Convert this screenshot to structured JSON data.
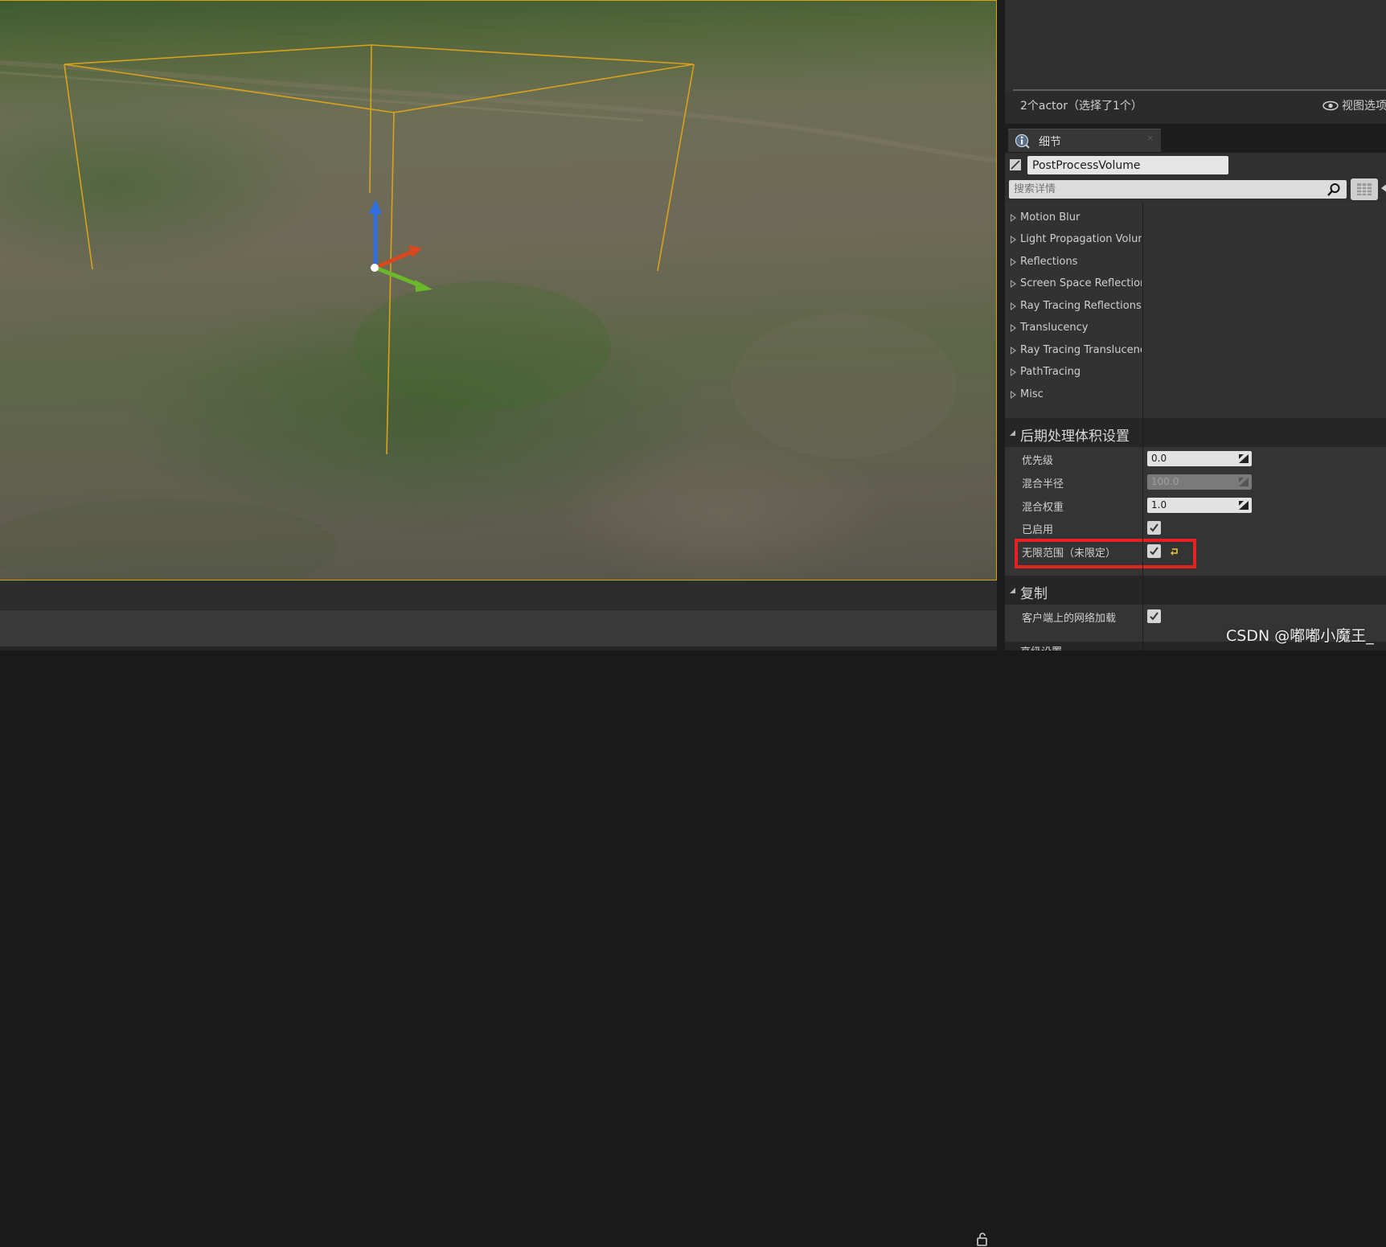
{
  "outliner": {
    "actor_count": "2个actor（选择了1个）",
    "view_options": "视图选项"
  },
  "details": {
    "tab_label": "细节",
    "tab_close": "×",
    "actor_name": "PostProcessVolume",
    "search_placeholder": "搜索详情",
    "categories": [
      "Motion Blur",
      "Light Propagation Volume",
      "Reflections",
      "Screen Space Reflections",
      "Ray Tracing Reflections",
      "Translucency",
      "Ray Tracing Translucency",
      "PathTracing",
      "Misc"
    ],
    "volume_settings": {
      "header": "后期处理体积设置",
      "priority_label": "优先级",
      "priority_value": "0.0",
      "blend_radius_label": "混合半径",
      "blend_radius_value": "100.0",
      "blend_weight_label": "混合权重",
      "blend_weight_value": "1.0",
      "enabled_label": "已启用",
      "enabled_checked": true,
      "unbound_label": "无限范围（未限定）",
      "unbound_checked": true
    },
    "replication": {
      "header": "复制",
      "net_load_label": "客户端上的网络加载",
      "net_load_checked": true
    },
    "next_section_partial": "高级设置"
  },
  "watermark": "CSDN @嘟嘟小魔王_",
  "colors": {
    "selection_outline": "#d4a417",
    "highlight_box": "#e42222",
    "gizmo_x": "#d9471f",
    "gizmo_y": "#6bb82a",
    "gizmo_z": "#2f6fe0"
  }
}
